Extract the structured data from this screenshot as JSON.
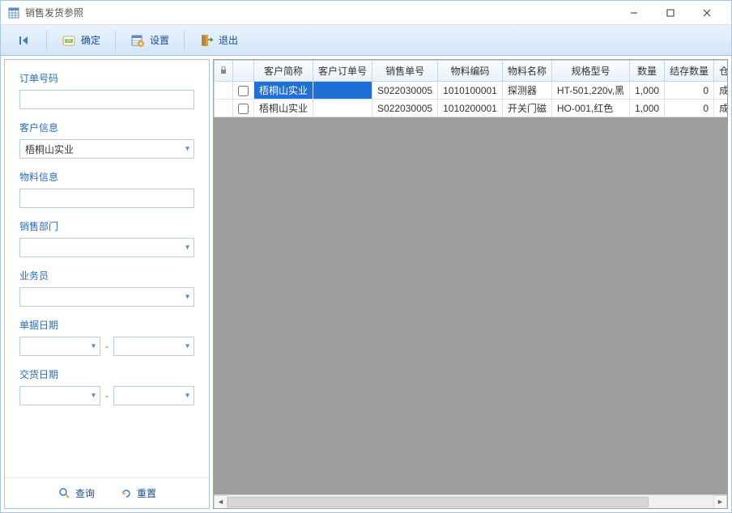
{
  "window": {
    "title": "销售发货参照"
  },
  "toolbar": {
    "ok": "确定",
    "settings": "设置",
    "exit": "退出"
  },
  "sidebar": {
    "order_no_label": "订单号码",
    "order_no_value": "",
    "customer_label": "客户信息",
    "customer_value": "梧桐山实业",
    "material_label": "物料信息",
    "material_value": "",
    "sales_dept_label": "销售部门",
    "sales_dept_value": "",
    "salesman_label": "业务员",
    "salesman_value": "",
    "doc_date_label": "单据日期",
    "doc_date_from": "",
    "doc_date_to": "",
    "delivery_date_label": "交货日期",
    "delivery_date_from": "",
    "delivery_date_to": "",
    "date_sep": "-",
    "query_btn": "查询",
    "reset_btn": "重置"
  },
  "grid": {
    "columns": [
      "",
      "客户简称",
      "客户订单号",
      "销售单号",
      "物料编码",
      "物料名称",
      "规格型号",
      "数量",
      "结存数量",
      "仓库名称"
    ],
    "rows": [
      {
        "customer": "梧桐山实业",
        "cust_order": "",
        "sales_no": "S022030005",
        "material_code": "1010100001",
        "material_name": "探测器",
        "spec": "HT-501,220v,黑",
        "qty": "1,000",
        "balance": "0",
        "warehouse": "成品仓",
        "selected": true
      },
      {
        "customer": "梧桐山实业",
        "cust_order": "",
        "sales_no": "S022030005",
        "material_code": "1010200001",
        "material_name": "开关门磁",
        "spec": "HO-001,红色",
        "qty": "1,000",
        "balance": "0",
        "warehouse": "成品仓",
        "selected": false
      }
    ]
  }
}
